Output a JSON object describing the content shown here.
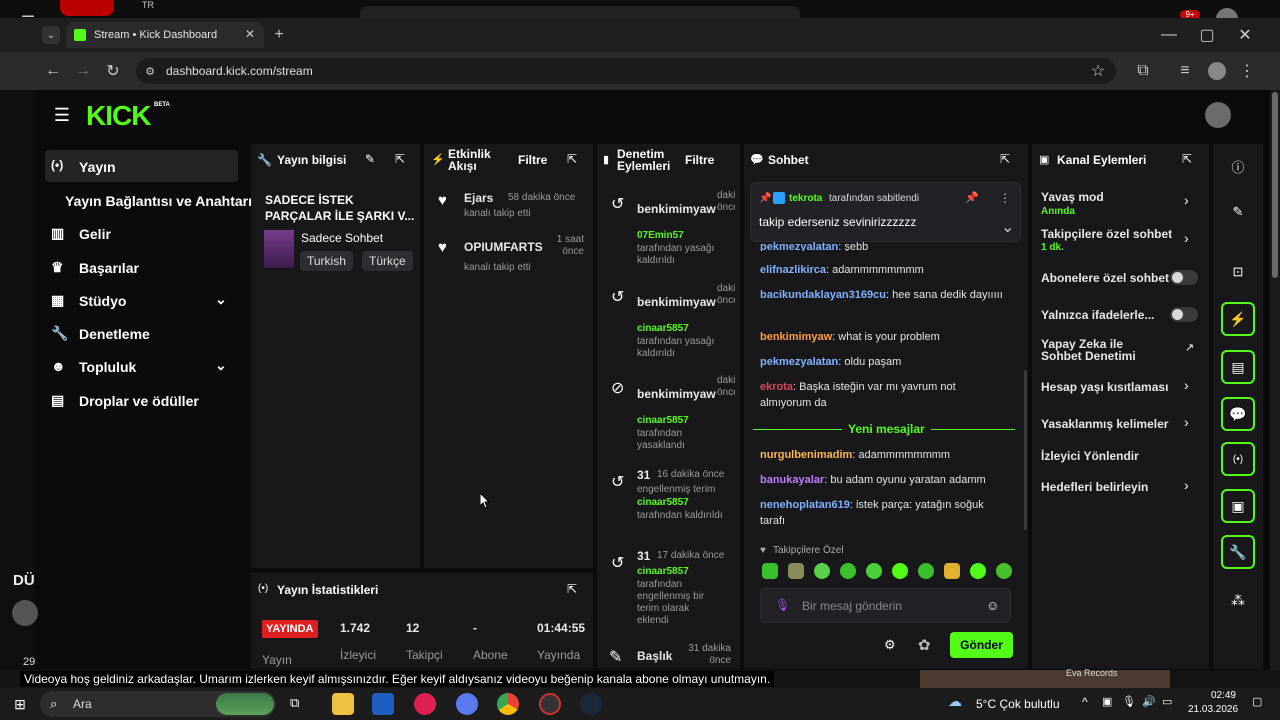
{
  "browser": {
    "tab_title": "Stream • Kick Dashboard",
    "url": "dashboard.kick.com/stream"
  },
  "top_strip": {
    "lang": "TR",
    "badge": "9+"
  },
  "brand": {
    "logo": "KICK",
    "beta": "BETA",
    "accent": "#53fc18"
  },
  "sidebar": {
    "items": [
      {
        "label": "Yayın",
        "icon": "broadcast-icon"
      },
      {
        "label": "Yayın Bağlantısı ve Anahtarı",
        "icon": ""
      },
      {
        "label": "Gelir",
        "icon": "chart-icon"
      },
      {
        "label": "Başarılar",
        "icon": "trophy-icon"
      },
      {
        "label": "Stüdyo",
        "icon": "studio-icon"
      },
      {
        "label": "Denetleme",
        "icon": "wrench-icon"
      },
      {
        "label": "Topluluk",
        "icon": "community-icon"
      },
      {
        "label": "Droplar ve ödüller",
        "icon": "gift-icon"
      }
    ]
  },
  "stream_info": {
    "header": "Yayın bilgisi",
    "title": "SADECE İSTEK PARÇALAR İLE ŞARKI V...",
    "category": "Sadece Sohbet",
    "tags": [
      "Turkish",
      "Türkçe"
    ]
  },
  "activity": {
    "header": "Etkinlik Akışı",
    "filter": "Filtre",
    "items": [
      {
        "user": "Ejars",
        "time": "58 dakika önce",
        "text": "kanalı takip etti"
      },
      {
        "user": "OPIUMFARTS",
        "time": "1 saat önce",
        "text": "kanalı takip etti"
      }
    ]
  },
  "moderation": {
    "header": "Denetim Eylemleri",
    "filter": "Filtre",
    "items": [
      {
        "title": "benkimimyaw",
        "time": "dakika önce",
        "actor": "07Emin57",
        "text": "tarafından yasağı kaldırıldı"
      },
      {
        "title": "benkimimyaw",
        "time": "dakika önce",
        "actor": "cinaar5857",
        "text": "tarafından yasağı kaldırıldı"
      },
      {
        "title": "benkimimyaw",
        "time": "dakika önce",
        "actor": "cinaar5857",
        "text": "tarafından yasaklandı"
      },
      {
        "title": "31",
        "time": "16 dakika önce",
        "prefix": "engellenmiş terim",
        "actor": "cinaar5857",
        "text": "tarafından kaldırıldı"
      },
      {
        "title": "31",
        "time": "17 dakika önce",
        "actor": "cinaar5857",
        "text": "tarafından engellenmiş bir terim olarak eklendi"
      },
      {
        "title": "Başlık",
        "time": "31 dakika önce",
        "actor": "",
        "text": ""
      }
    ]
  },
  "chat": {
    "header": "Sohbet",
    "pinned_by": "tekrota",
    "pinned_label": "tarafından sabitlendi",
    "pinned_text": "takip ederseniz sevinirizzzzzz",
    "messages": [
      {
        "user": "pekmezyalatan",
        "text": "şebb",
        "color": "#7fb2ff"
      },
      {
        "user": "elifnazlikirca",
        "text": "adammmmmmmm",
        "color": "#7fb2ff"
      },
      {
        "user": "bacikundaklayan3169cu",
        "text": "hee sana dedik dayııııı",
        "color": "#7fb2ff"
      },
      {
        "user": "benkimimyaw",
        "text": "what is your problem",
        "color": "#ff9c3a"
      },
      {
        "user": "pekmezyalatan",
        "text": "oldu paşam",
        "color": "#7fb2ff"
      },
      {
        "user": "ekrota",
        "text": "Başka isteğin var mı yavrum not almıyorum da",
        "color": "#e0455b"
      }
    ],
    "new_messages": "Yeni mesajlar",
    "messages_new": [
      {
        "user": "nurgulbenimadim",
        "text": "adammmmmmmm",
        "color": "#ffb84d"
      },
      {
        "user": "banukayalar",
        "text": "bu adam oyunu yaratan adamm",
        "color": "#c07bff"
      },
      {
        "user": "nenehoplatan619",
        "text": "istek parça: yatağın soğuk tarafı",
        "color": "#7fb2ff"
      }
    ],
    "follower_only": "Takipçilere Özel",
    "input_placeholder": "Bir mesaj gönderin",
    "send": "Gönder"
  },
  "channel_actions": {
    "header": "Kanal Eylemleri",
    "items": [
      {
        "label": "Yavaş mod",
        "sub": "Anında",
        "control": "chevron"
      },
      {
        "label": "Takipçilere özel sohbet",
        "sub": "1 dk.",
        "control": "chevron"
      },
      {
        "label": "Abonelere özel sohbet",
        "sub": "",
        "control": "toggle"
      },
      {
        "label": "Yalnızca ifadelerle...",
        "sub": "",
        "control": "toggle"
      },
      {
        "label": "Yapay Zeka ile Sohbet Denetimi",
        "sub": "",
        "control": "external"
      },
      {
        "label": "Hesap yaşı kısıtlaması",
        "sub": "",
        "control": "chevron"
      },
      {
        "label": "Yasaklanmış kelimeler",
        "sub": "",
        "control": "chevron"
      },
      {
        "label": "İzleyici Yönlendir",
        "sub": "",
        "control": "none"
      },
      {
        "label": "Hedefleri belirleyin",
        "sub": "",
        "control": "chevron"
      }
    ]
  },
  "stats": {
    "header": "Yayın İstatistikleri",
    "live": "YAYINDA",
    "viewers": "1.742",
    "followers": "12",
    "subs": "-",
    "uptime": "01:44:55",
    "labels": [
      "Yayın",
      "İzleyici",
      "Takipçi",
      "Abone",
      "Yayında"
    ]
  },
  "caption": "Videoya hoş geldiniz arkadaşlar. Umarım izlerken keyif almışsınızdır. Eğer keyif aldıysanız videoyu beğenip kanala abone olmayı unutmayın.",
  "left_peek": {
    "text1": "DÜ",
    "text2": "29"
  },
  "taskbar": {
    "search": "Ara",
    "weather": "5°C  Çok bulutlu",
    "time": "02:49",
    "date": "21.03.2026",
    "media": "Eva Records"
  }
}
